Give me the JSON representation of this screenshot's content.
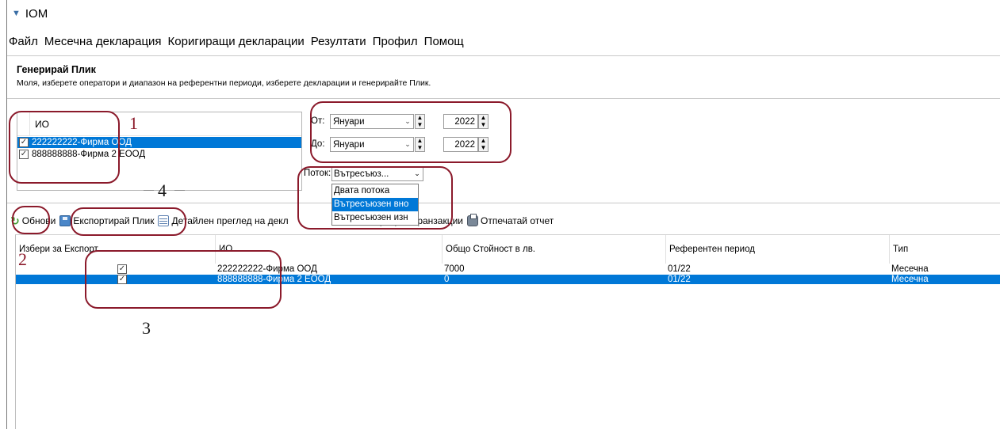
{
  "window": {
    "title": "IOM"
  },
  "menu": [
    "Файл",
    "Месечна декларация",
    "Коригиращи декларации",
    "Резултати",
    "Профил",
    "Помощ"
  ],
  "header": {
    "title": "Генерирай Плик",
    "subtitle": "Моля, изберете оператори и диапазон на референтни периоди, изберете декларации и генерирайте Плик."
  },
  "operators": {
    "column": "ИО",
    "rows": [
      {
        "name": "222222222-Фирма ООД",
        "checked": true,
        "selected": true
      },
      {
        "name": "888888888-Фирма 2 ЕООД",
        "checked": true,
        "selected": false
      }
    ]
  },
  "period": {
    "from_label": "От:",
    "to_label": "До:",
    "from_month": "Януари",
    "to_month": "Януари",
    "from_year": "2022",
    "to_year": "2022"
  },
  "stream": {
    "label": "Поток:",
    "value": "Вътресъюз...",
    "options": [
      "Двата потока",
      "Вътресъюзен вно",
      "Вътресъюзен изн"
    ],
    "highlighted_index": 1
  },
  "toolbar": {
    "refresh": "Обнови",
    "export": "Експортирай Плик",
    "details": "Детайлен преглед на декл",
    "import_tx": "портирай транзакции",
    "print": "Отпечатай отчет"
  },
  "table": {
    "headers": [
      "Избери за Експорт",
      "ИО",
      "Общо Стойност в лв.",
      "Референтен период",
      "Тип"
    ],
    "rows": [
      {
        "checked": true,
        "io": "222222222-Фирма ООД",
        "total": "7000",
        "period": "01/22",
        "type": "Месечна",
        "selected": false
      },
      {
        "checked": true,
        "io": "888888888-Фирма 2 ЕООД",
        "total": "0",
        "period": "01/22",
        "type": "Месечна",
        "selected": true
      }
    ]
  },
  "annotations": [
    "1",
    "2",
    "3",
    "4"
  ],
  "colors": {
    "selection": "#0078d7",
    "annotation": "#8b1a2b"
  }
}
